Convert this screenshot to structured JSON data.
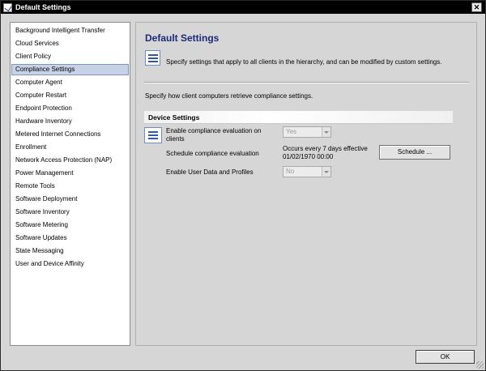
{
  "window": {
    "title": "Default Settings",
    "close_glyph": "✕"
  },
  "nav": {
    "items": [
      "Background Intelligent Transfer",
      "Cloud Services",
      "Client Policy",
      "Compliance Settings",
      "Computer Agent",
      "Computer Restart",
      "Endpoint Protection",
      "Hardware Inventory",
      "Metered Internet Connections",
      "Enrollment",
      "Network Access Protection (NAP)",
      "Power Management",
      "Remote Tools",
      "Software Deployment",
      "Software Inventory",
      "Software Metering",
      "Software Updates",
      "State Messaging",
      "User and Device Affinity"
    ],
    "selected": "Compliance Settings"
  },
  "main": {
    "title": "Default Settings",
    "description": "Specify settings that apply to all clients in the hierarchy, and can be modified by custom settings.",
    "subtext": "Specify how client computers retrieve compliance settings.",
    "section_header": "Device Settings",
    "settings": [
      {
        "label_line1": "Enable compliance evaluation on",
        "label_line2": "clients",
        "value": "Yes"
      },
      {
        "label": "Schedule compliance evaluation",
        "value_line1": "Occurs every 7 days effective",
        "value_line2": "01/02/1970 00:00"
      },
      {
        "label": "Enable User Data and Profiles",
        "value": "No"
      }
    ],
    "schedule_button": "Schedule ..."
  },
  "footer": {
    "ok_label": "OK"
  },
  "colors": {
    "title_text": "#1b2a7a",
    "selection_bg": "#c7d2e6",
    "titlebar_bg": "#000000"
  }
}
